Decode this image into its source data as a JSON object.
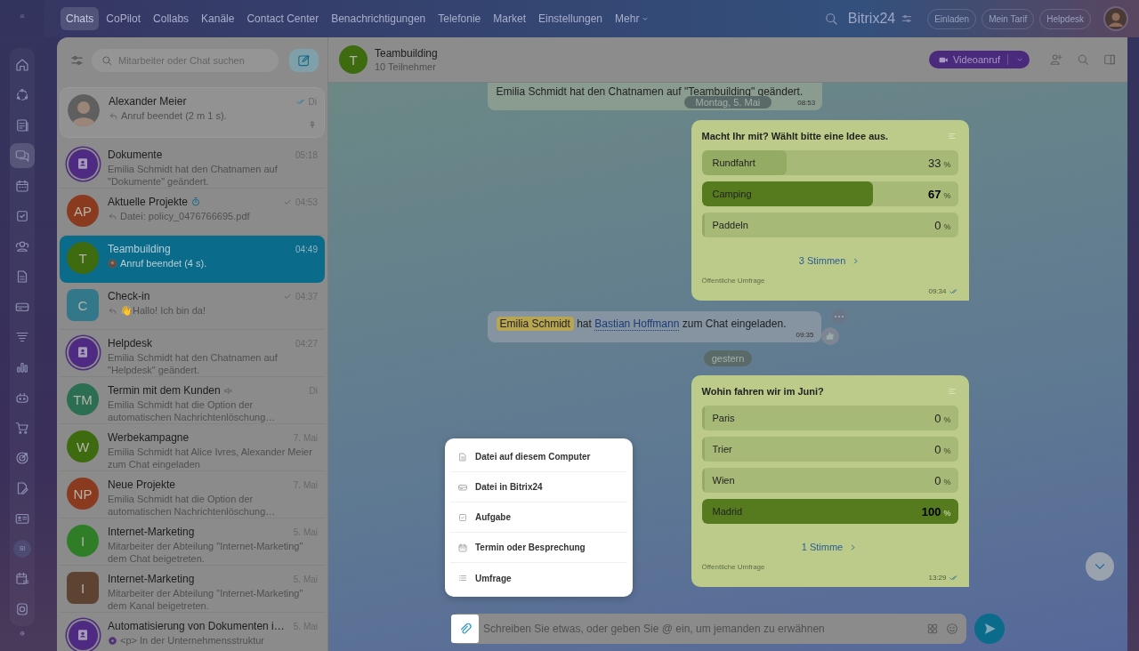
{
  "rail": {
    "items": [
      {
        "kind": "home",
        "selected": false
      },
      {
        "kind": "ring",
        "selected": false
      },
      {
        "kind": "news",
        "selected": false
      },
      {
        "kind": "chats",
        "selected": true
      },
      {
        "kind": "calendar",
        "selected": false
      },
      {
        "kind": "tasks",
        "selected": false
      },
      {
        "kind": "users",
        "selected": false
      },
      {
        "kind": "doc",
        "selected": false
      },
      {
        "kind": "drive",
        "selected": false
      },
      {
        "kind": "funnel",
        "selected": false
      },
      {
        "kind": "chart",
        "selected": false
      },
      {
        "kind": "robot",
        "selected": false
      },
      {
        "kind": "cart",
        "selected": false
      },
      {
        "kind": "target",
        "selected": false
      },
      {
        "kind": "sign",
        "selected": false
      },
      {
        "kind": "card",
        "selected": false
      },
      {
        "kind": "avatar",
        "text": "SI",
        "selected": false
      },
      {
        "kind": "schedule",
        "selected": false
      },
      {
        "kind": "disc",
        "selected": false
      }
    ]
  },
  "top_tabs": [
    {
      "label": "Chats",
      "selected": true
    },
    {
      "label": "CoPilot",
      "selected": false
    },
    {
      "label": "Collabs",
      "selected": false
    },
    {
      "label": "Kanäle",
      "selected": false
    },
    {
      "label": "Contact Center",
      "selected": false
    },
    {
      "label": "Benachrichtigungen",
      "selected": false
    },
    {
      "label": "Telefonie",
      "selected": false
    },
    {
      "label": "Market",
      "selected": false
    },
    {
      "label": "Einstellungen",
      "selected": false
    },
    {
      "label": "Mehr",
      "selected": false
    }
  ],
  "brand": "Bitrix24",
  "top_buttons": [
    "Einladen",
    "Mein Tarif",
    "Helpdesk"
  ],
  "chat_list": {
    "search": {
      "placeholder": "Mitarbeiter oder Chat suchen"
    },
    "chats": [
      {
        "name": "Alexander Meier",
        "time": "Di",
        "preview": {
          "kind": "reply",
          "text": "Anruf beendet (2 m 1 s)."
        },
        "avatar": {
          "kind": "photo"
        },
        "receipt": {
          "kind": "read"
        },
        "selected": false,
        "pinned": true
      },
      {
        "name": "Dokumente",
        "time": "05:18",
        "preview": {
          "kind": "text",
          "text": "Emilia Schmidt hat den Chatnamen auf \"Dokumente\" geändert."
        },
        "avatar": {
          "kind": "group",
          "color": "#4e2a82"
        },
        "selected": false,
        "pinned": false
      },
      {
        "name": "Aktuelle Projekte",
        "time": "04:53",
        "preview": {
          "kind": "reply",
          "text": "Datei: policy_0476766695.pdf"
        },
        "avatar": {
          "kind": "initials",
          "text": "AP",
          "color": "#8a3a1e"
        },
        "name_icon": {
          "kind": "timer"
        },
        "receipt": {
          "kind": "sent"
        },
        "selected": false,
        "pinned": false
      },
      {
        "name": "Teambuilding",
        "time": "04:49",
        "preview": {
          "kind": "user",
          "text": "Anruf beendet (4 s)."
        },
        "avatar": {
          "kind": "initials",
          "text": "T",
          "color": "#3e6a10"
        },
        "selected": true,
        "pinned": false
      },
      {
        "name": "Check-in",
        "time": "04:37",
        "preview": {
          "kind": "reply",
          "text": "👋Hallo! Ich bin da!"
        },
        "avatar": {
          "kind": "tile",
          "text": "C",
          "color": "#33778a"
        },
        "receipt": {
          "kind": "sent"
        },
        "selected": false,
        "pinned": false
      },
      {
        "name": "Helpdesk",
        "time": "04:27",
        "preview": {
          "kind": "text",
          "text": "Emilia Schmidt hat den Chatnamen auf \"Helpdesk\" geändert."
        },
        "avatar": {
          "kind": "group",
          "color": "#4e2a82"
        },
        "selected": false,
        "pinned": false
      },
      {
        "name": "Termin mit dem Kunden",
        "time": "Di",
        "preview": {
          "kind": "text",
          "text": "Emilia Schmidt hat die Option der automatischen Nachrichtenlöschung…"
        },
        "avatar": {
          "kind": "initials",
          "text": "TM",
          "color": "#2c6e52"
        },
        "name_icon": {
          "kind": "muted"
        },
        "selected": false,
        "pinned": false
      },
      {
        "name": "Werbekampagne",
        "time": "7. Mai",
        "preview": {
          "kind": "text",
          "text": "Emilia Schmidt hat Alice Ivres, Alexander Meier zum Chat eingeladen"
        },
        "avatar": {
          "kind": "initials",
          "text": "W",
          "color": "#3e6a10"
        },
        "selected": false,
        "pinned": false
      },
      {
        "name": "Neue Projekte",
        "time": "7. Mai",
        "preview": {
          "kind": "text",
          "text": "Emilia Schmidt hat die Option der automatischen Nachrichtenlöschung…"
        },
        "avatar": {
          "kind": "initials",
          "text": "NP",
          "color": "#8a3a1e"
        },
        "selected": false,
        "pinned": false
      },
      {
        "name": "Internet-Marketing",
        "time": "5. Mai",
        "preview": {
          "kind": "text",
          "text": "Mitarbeiter der Abteilung \"Internet-Marketing\" dem Chat beigetreten."
        },
        "avatar": {
          "kind": "initials",
          "text": "I",
          "color": "#2f7d26"
        },
        "selected": false,
        "pinned": false
      },
      {
        "name": "Internet-Marketing",
        "time": "5. Mai",
        "preview": {
          "kind": "text",
          "text": "Mitarbeiter der Abteilung \"Internet-Marketing\" dem Kanal beigetreten."
        },
        "avatar": {
          "kind": "tile",
          "text": "I",
          "color": "#5e4232"
        },
        "selected": false,
        "pinned": false
      },
      {
        "name": "Automatisierung von Dokumenten i…",
        "time": "5. Mai",
        "preview": {
          "kind": "bot",
          "text": "<p> In der Unternehmensstruktur"
        },
        "avatar": {
          "kind": "group",
          "color": "#4e2a82"
        },
        "selected": false,
        "pinned": false
      }
    ]
  },
  "chat": {
    "title": "Teambuilding",
    "subtitle": "10 Teilnehmer",
    "avatar": {
      "text": "T",
      "color": "#3e6a10"
    },
    "video_button": "Videoanruf",
    "messages": [
      {
        "kind": "system",
        "parts": [
          {
            "kind": "text",
            "text": "Emilia Schmidt hat den Chatnamen auf \"Teambuilding\" geändert."
          }
        ],
        "time": "08:53",
        "date": "Montag, 5. Mai"
      },
      {
        "kind": "poll",
        "question": "Macht Ihr mit? Wählt bitte eine Idee aus.",
        "options": [
          {
            "label": "Rundfahrt",
            "value": "33",
            "unit": "%",
            "level": 0.33,
            "leading": false
          },
          {
            "label": "Camping",
            "value": "67",
            "unit": "%",
            "level": 0.67,
            "leading": true
          },
          {
            "label": "Paddeln",
            "value": "0",
            "unit": "%",
            "level": 0,
            "leading": false
          }
        ],
        "votes": "3 Stimmen",
        "footer": "Öffentliche Umfrage",
        "time": "09:34"
      },
      {
        "kind": "system",
        "parts": [
          {
            "kind": "mention",
            "text": "Emilia Schmidt"
          },
          {
            "kind": "text",
            "text": " hat "
          },
          {
            "kind": "link",
            "text": "Bastian Hoffmann"
          },
          {
            "kind": "text",
            "text": " zum Chat eingeladen."
          }
        ],
        "time": "09:35"
      },
      {
        "kind": "date",
        "text": "gestern"
      },
      {
        "kind": "poll",
        "question": "Wohin fahren wir im Juni?",
        "options": [
          {
            "label": "Paris",
            "value": "0",
            "unit": "%",
            "level": 0,
            "leading": false
          },
          {
            "label": "Trier",
            "value": "0",
            "unit": "%",
            "level": 0,
            "leading": false
          },
          {
            "label": "Wien",
            "value": "0",
            "unit": "%",
            "level": 0,
            "leading": false
          },
          {
            "label": "Madrid",
            "value": "100",
            "unit": "%",
            "level": 1,
            "leading": true
          }
        ],
        "votes": "1 Stimme",
        "footer": "Öffentliche Umfrage",
        "time": "13:29"
      }
    ],
    "attach_menu": [
      {
        "kind": "file",
        "label": "Datei auf diesem Computer"
      },
      {
        "kind": "drive",
        "label": "Datei in Bitrix24"
      },
      {
        "kind": "task",
        "label": "Aufgabe"
      },
      {
        "kind": "calendar",
        "label": "Termin oder Besprechung"
      },
      {
        "kind": "list",
        "label": "Umfrage"
      }
    ],
    "composer": {
      "placeholder": "Schreiben Sie etwas, oder geben Sie @ ein, um jemanden zu erwähnen"
    }
  }
}
